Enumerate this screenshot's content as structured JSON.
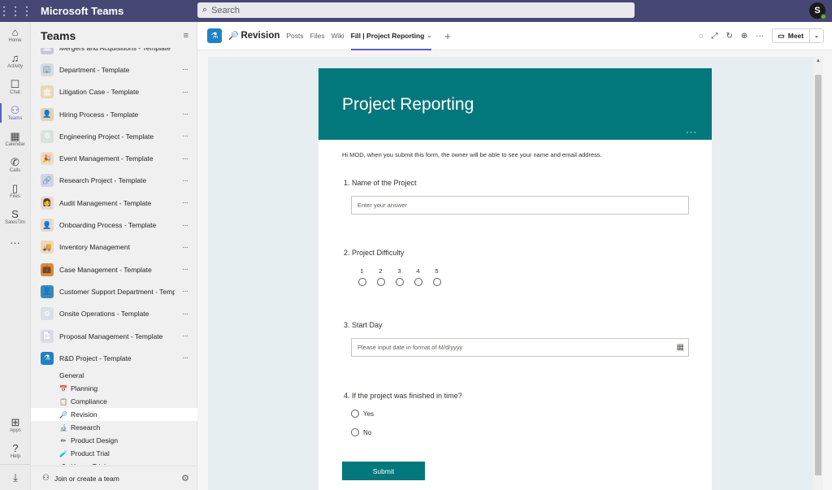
{
  "app": {
    "name": "Microsoft Teams"
  },
  "search": {
    "placeholder": "Search"
  },
  "user": {
    "initial": "S"
  },
  "rail": [
    {
      "label": "Home",
      "icon": "⌂"
    },
    {
      "label": "Activity",
      "icon": "🔔"
    },
    {
      "label": "Chat",
      "icon": "💬"
    },
    {
      "label": "Teams",
      "icon": "👥"
    },
    {
      "label": "Calendar",
      "icon": "▦"
    },
    {
      "label": "Calls",
      "icon": "✆"
    },
    {
      "label": "Files",
      "icon": "🗎"
    },
    {
      "label": "SalesTim",
      "icon": "S"
    },
    {
      "label": "",
      "icon": "···"
    }
  ],
  "rail_bottom": [
    {
      "label": "Apps",
      "icon": "⊞"
    },
    {
      "label": "Help",
      "icon": "?"
    },
    {
      "label": "",
      "icon": "⤓"
    }
  ],
  "sidebar": {
    "title": "Teams",
    "teams": [
      {
        "name": "Mergers and Acquisitions - Template",
        "color": "#c7c7d9",
        "icon": "🏛"
      },
      {
        "name": "Department - Template",
        "color": "#d0dce8",
        "icon": "🏢"
      },
      {
        "name": "Litigation Case - Template",
        "color": "#e6d8b8",
        "icon": "🏛"
      },
      {
        "name": "Hiring Process - Template",
        "color": "#e0d2b4",
        "icon": "👤"
      },
      {
        "name": "Engineering Project - Template",
        "color": "#d6e4dc",
        "icon": "⚙"
      },
      {
        "name": "Event Management - Template",
        "color": "#f0dcc0",
        "icon": "🎉"
      },
      {
        "name": "Research Project - Template",
        "color": "#d8d0e8",
        "icon": "🔗"
      },
      {
        "name": "Audit Management - Template",
        "color": "#e8d8d0",
        "icon": "👩"
      },
      {
        "name": "Onboarding Process - Template",
        "color": "#e8d8c8",
        "icon": "👤"
      },
      {
        "name": "Inventory Management",
        "color": "#f0d8b0",
        "icon": "🚚"
      },
      {
        "name": "Case Management - Template",
        "color": "#d88a3a",
        "icon": "💼"
      },
      {
        "name": "Customer Support Department - Template",
        "color": "#3a8ab0",
        "icon": "👤"
      },
      {
        "name": "Onsite Operations - Template",
        "color": "#d8e0e8",
        "icon": "⚙"
      },
      {
        "name": "Proposal Management - Template",
        "color": "#e0d8e8",
        "icon": "📄"
      },
      {
        "name": "R&D Project - Template",
        "color": "#1f82c4",
        "icon": "⚗"
      }
    ],
    "channels": [
      {
        "name": "General",
        "icon": ""
      },
      {
        "name": "Planning",
        "icon": "📅"
      },
      {
        "name": "Compliance",
        "icon": "📋"
      },
      {
        "name": "Revision",
        "icon": "🔎"
      },
      {
        "name": "Research",
        "icon": "🔬"
      },
      {
        "name": "Product Design",
        "icon": "✏"
      },
      {
        "name": "Product Trial",
        "icon": "🧪"
      },
      {
        "name": "Usage Trial",
        "icon": "⚗"
      }
    ],
    "join_label": "Join or create a team"
  },
  "header": {
    "channel": "Revision",
    "tabs": [
      "Posts",
      "Files",
      "Wiki",
      "Fill | Project Reporting"
    ],
    "meet_label": "Meet"
  },
  "form": {
    "title": "Project Reporting",
    "intro": "Hi MOD, when you submit this form, the owner will be able to see your name and email address.",
    "q1": {
      "label": "1. Name of the Project",
      "placeholder": "Enter your answer"
    },
    "q2": {
      "label": "2. Project Difficulty",
      "scale": [
        "1",
        "2",
        "3",
        "4",
        "5"
      ]
    },
    "q3": {
      "label": "3. Start Day",
      "placeholder": "Please input date in format of M/d/yyyy"
    },
    "q4": {
      "label": "4. If the project was finished in time?",
      "options": [
        "Yes",
        "No"
      ]
    },
    "submit_label": "Submit"
  }
}
